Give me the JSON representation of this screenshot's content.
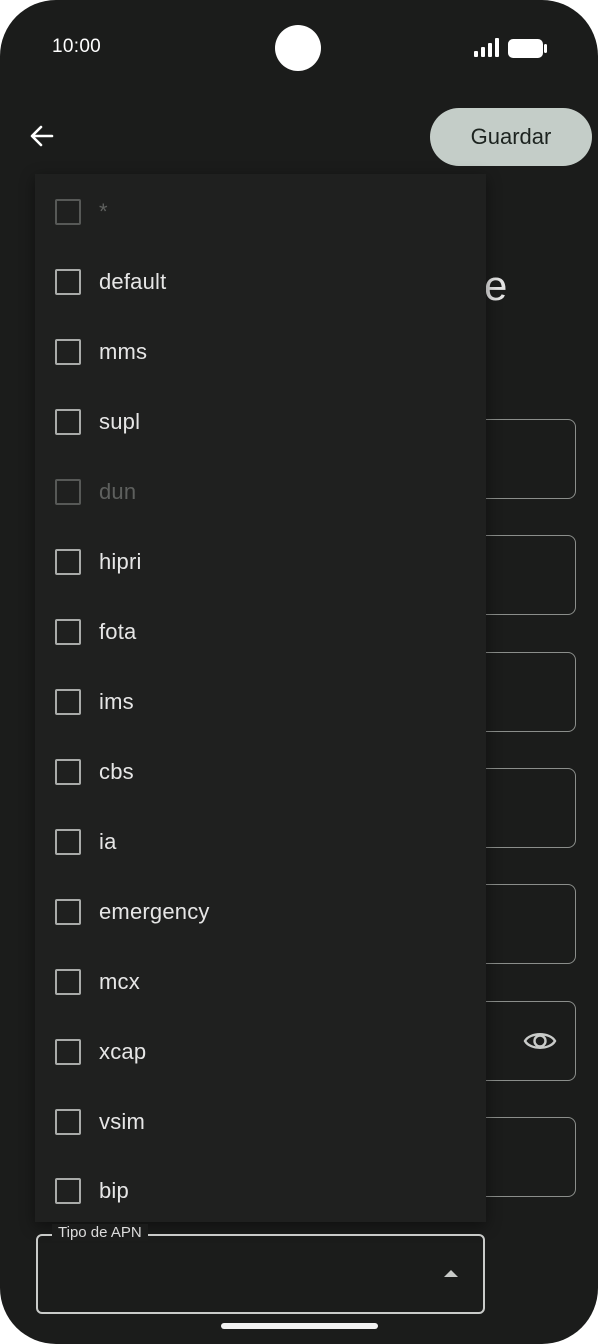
{
  "status_bar": {
    "time": "10:00"
  },
  "toolbar": {
    "save_label": "Guardar"
  },
  "background": {
    "title_fragment": "e"
  },
  "menu": {
    "items": [
      {
        "label": "*",
        "enabled": false
      },
      {
        "label": "default",
        "enabled": true
      },
      {
        "label": "mms",
        "enabled": true
      },
      {
        "label": "supl",
        "enabled": true
      },
      {
        "label": "dun",
        "enabled": false
      },
      {
        "label": "hipri",
        "enabled": true
      },
      {
        "label": "fota",
        "enabled": true
      },
      {
        "label": "ims",
        "enabled": true
      },
      {
        "label": "cbs",
        "enabled": true
      },
      {
        "label": "ia",
        "enabled": true
      },
      {
        "label": "emergency",
        "enabled": true
      },
      {
        "label": "mcx",
        "enabled": true
      },
      {
        "label": "xcap",
        "enabled": true
      },
      {
        "label": "vsim",
        "enabled": true
      },
      {
        "label": "bip",
        "enabled": true
      }
    ]
  },
  "apn_field": {
    "label": "Tipo de APN",
    "value": ""
  },
  "icons": {
    "back": "arrow-back-icon",
    "password_toggle": "eye-icon",
    "dropdown": "caret-up-icon",
    "signal": "cellular-signal-icon",
    "battery": "battery-icon"
  },
  "colors": {
    "background": "#1b1c1b",
    "save_button": "#c4cdc8",
    "menu_surface": "#1f201f"
  }
}
